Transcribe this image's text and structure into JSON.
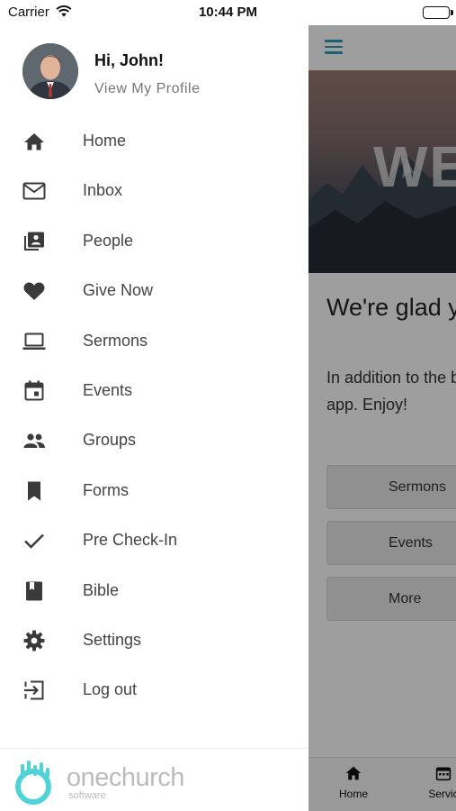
{
  "status_bar": {
    "carrier": "Carrier",
    "time": "10:44 PM"
  },
  "profile": {
    "greeting": "Hi, John!",
    "link": "View My Profile"
  },
  "menu": [
    {
      "label": "Home",
      "icon": "home-icon"
    },
    {
      "label": "Inbox",
      "icon": "mail-icon"
    },
    {
      "label": "People",
      "icon": "people-book-icon"
    },
    {
      "label": "Give Now",
      "icon": "heart-icon"
    },
    {
      "label": "Sermons",
      "icon": "laptop-icon"
    },
    {
      "label": "Events",
      "icon": "calendar-icon"
    },
    {
      "label": "Groups",
      "icon": "group-icon"
    },
    {
      "label": "Forms",
      "icon": "bookmark-icon"
    },
    {
      "label": "Pre Check-In",
      "icon": "check-icon"
    },
    {
      "label": "Bible",
      "icon": "book-icon"
    },
    {
      "label": "Settings",
      "icon": "gear-icon"
    },
    {
      "label": "Log out",
      "icon": "logout-icon"
    }
  ],
  "footer": {
    "logo_main": "onechurch",
    "logo_sub": "software"
  },
  "background_app": {
    "hero_text": "WE",
    "heading": "We're glad y",
    "paragraph": "In addition to the bars in the uppe app. Enjoy!",
    "buttons": [
      "Sermons",
      "Events",
      "More"
    ],
    "tabs": [
      "Home",
      "Servic"
    ]
  },
  "colors": {
    "accent": "#2a9db8",
    "logo_teal": "#4fd3d6",
    "dim_overlay": "rgba(0,0,0,0.38)"
  }
}
